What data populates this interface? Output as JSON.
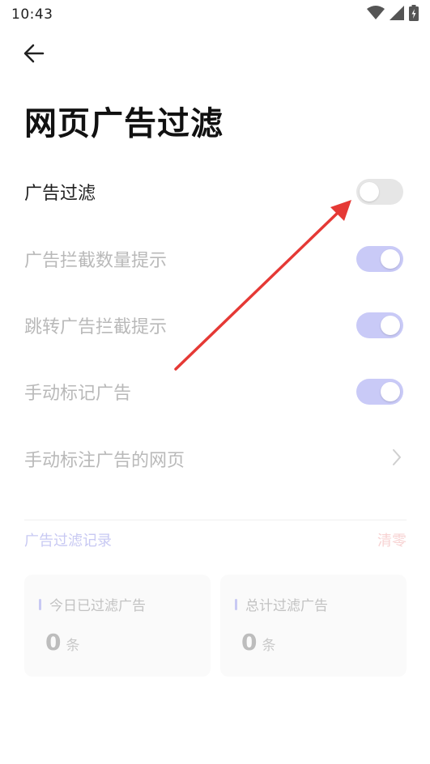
{
  "status_bar": {
    "time": "10:43"
  },
  "header": {
    "title": "网页广告过滤"
  },
  "settings": [
    {
      "label": "广告过滤",
      "enabled": true,
      "control": "toggle",
      "state": "off"
    },
    {
      "label": "广告拦截数量提示",
      "enabled": false,
      "control": "toggle",
      "state": "on"
    },
    {
      "label": "跳转广告拦截提示",
      "enabled": false,
      "control": "toggle",
      "state": "on"
    },
    {
      "label": "手动标记广告",
      "enabled": false,
      "control": "toggle",
      "state": "on"
    },
    {
      "label": "手动标注广告的网页",
      "enabled": false,
      "control": "chevron"
    }
  ],
  "records": {
    "section_title": "广告过滤记录",
    "clear_label": "清零",
    "cards": [
      {
        "title": "今日已过滤广告",
        "value": "0",
        "unit": "条"
      },
      {
        "title": "总计过滤广告",
        "value": "0",
        "unit": "条"
      }
    ]
  },
  "colors": {
    "accent": "#c9caf7",
    "toggle_off": "#e6e6e6",
    "annotation_arrow": "#e53935",
    "clear_text": "#f7d2d2"
  }
}
